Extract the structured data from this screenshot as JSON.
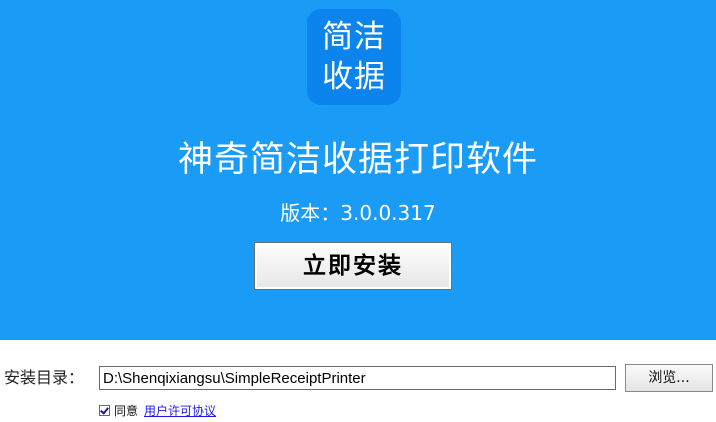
{
  "logo": {
    "line1": "简洁",
    "line2": "收据"
  },
  "app": {
    "title": "神奇简洁收据打印软件",
    "version": "版本：3.0.0.317"
  },
  "actions": {
    "install_label": "立即安装"
  },
  "install_dir": {
    "label": "安装目录：",
    "value": "D:\\Shenqixiangsu\\SimpleReceiptPrinter",
    "browse_label": "浏览..."
  },
  "agreement": {
    "checked": true,
    "text": "同意",
    "link_text": "用户许可协议"
  },
  "colors": {
    "banner": "#1a9bf5",
    "logo": "#0b84ee",
    "link": "#1a1ae6"
  }
}
